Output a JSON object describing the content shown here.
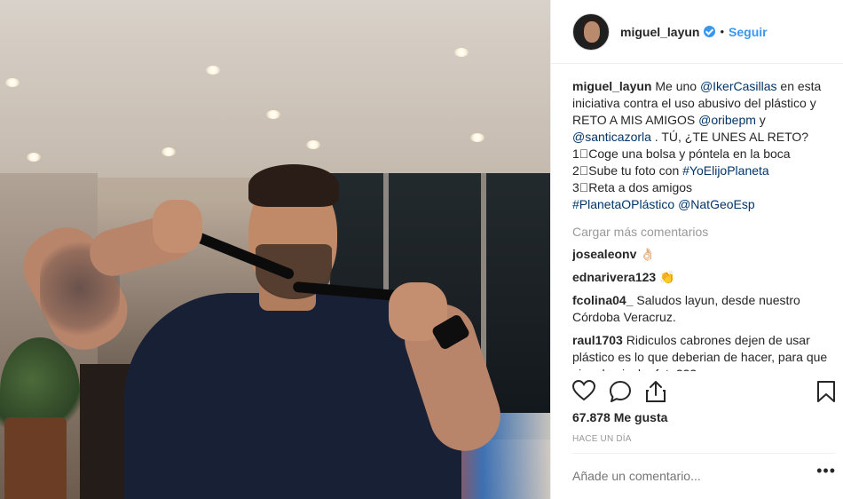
{
  "post": {
    "username": "miguel_layun",
    "follow_label": "Seguir",
    "separator": "•"
  },
  "caption": {
    "username": "miguel_layun",
    "t1": " Me uno ",
    "m1": "@IkerCasillas",
    "t2": " en esta iniciativa contra el uso abusivo del plástico y RETO A MIS AMIGOS ",
    "m2": "@oribepm",
    "t3": " y ",
    "m3": "@santicazorla",
    "t4": " . TÚ, ¿TE UNES AL RETO?",
    "step1": "1⃣Coge una bolsa y póntela en la boca",
    "step2_prefix": "2⃣Sube tu foto con ",
    "step2_tag": "#YoElijoPlaneta",
    "step3": "3⃣Reta a dos amigos",
    "tag2": "#PlanetaOPlástico",
    "m4": "@NatGeoEsp"
  },
  "load_more_label": "Cargar más comentarios",
  "comments": [
    {
      "user": "josealeonv",
      "text": "",
      "emoji": "👌🏻"
    },
    {
      "user": "ednarivera123",
      "text": "",
      "emoji": "👏"
    },
    {
      "user": "fcolina04_",
      "text": "Saludos layun, desde nuestro Córdoba Veracruz.",
      "emoji": ""
    },
    {
      "user": "raul1703",
      "text": "Ridiculos cabrones dejen de usar plástico es lo que deberian de hacer, para que sirve la pinche foto???",
      "emoji": ""
    }
  ],
  "actions": {
    "like_icon": "heart-icon",
    "comment_icon": "comment-icon",
    "share_icon": "share-icon",
    "save_icon": "bookmark-icon"
  },
  "likes_text": "67.878 Me gusta",
  "time_ago": "HACE UN DÍA",
  "add_comment_placeholder": "Añade un comentario...",
  "more_label": "•••"
}
